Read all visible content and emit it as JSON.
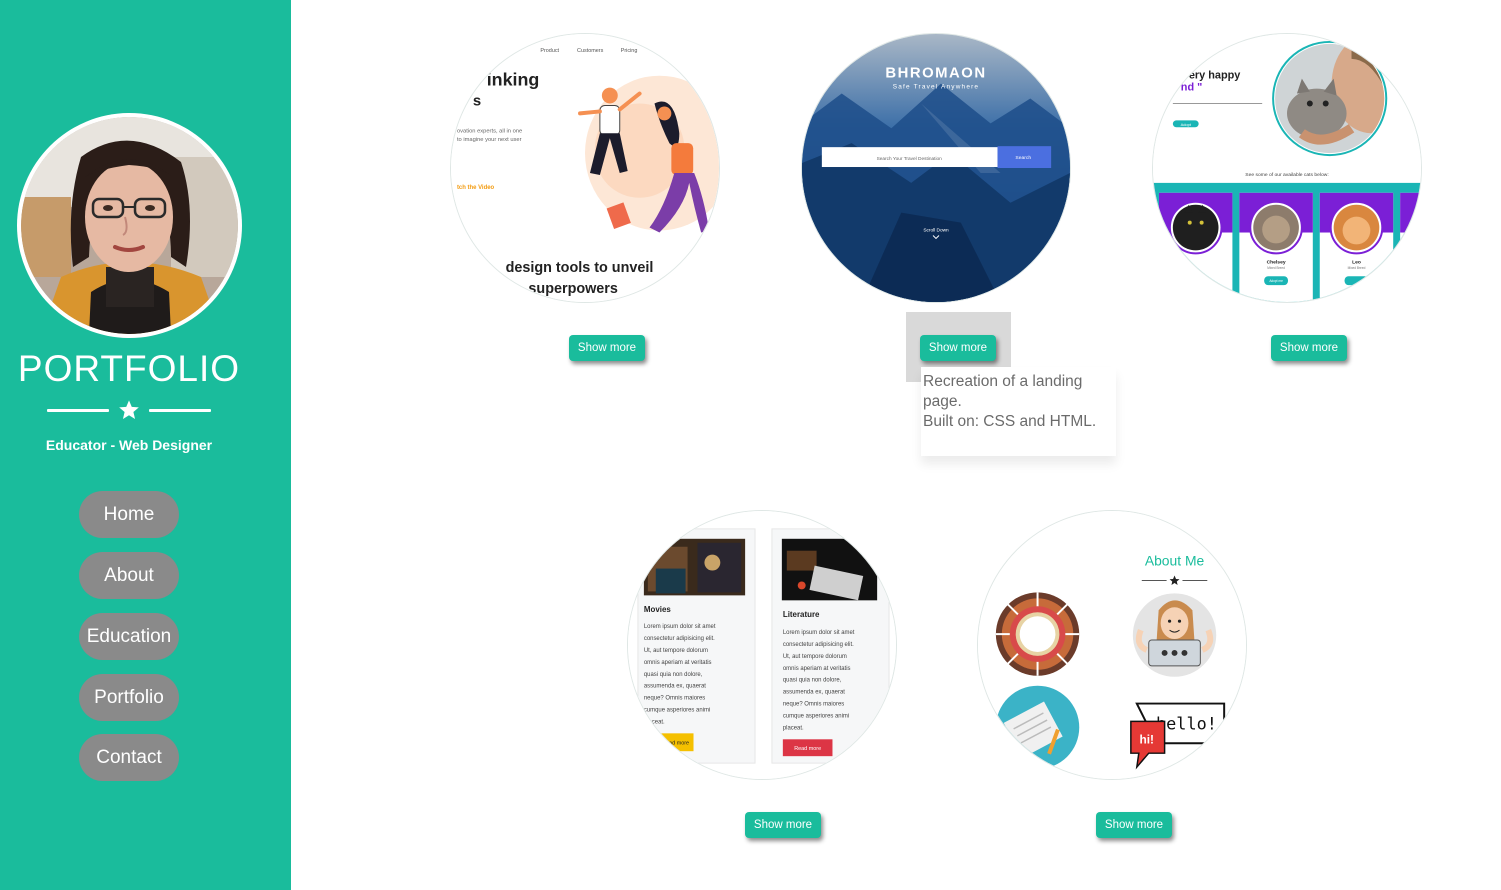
{
  "sidebar": {
    "title": "PORTFOLIO",
    "tagline": "Educator - Web Designer",
    "nav": [
      {
        "label": "Home"
      },
      {
        "label": "About"
      },
      {
        "label": "Education"
      },
      {
        "label": "Portfolio"
      },
      {
        "label": "Contact"
      }
    ]
  },
  "projects": [
    {
      "button": "Show more",
      "preview": {
        "nav": [
          "Product",
          "Customers",
          "Pricing"
        ],
        "heading_1": "inking",
        "heading_2": "s",
        "body_1": "ovation experts, all in one",
        "body_2": "to imagine your next user",
        "link": "tch the Video",
        "footer_1": "design tools to unveil",
        "footer_2": "superpowers"
      }
    },
    {
      "button": "Show more",
      "preview": {
        "brand": "BHROMAON",
        "subtitle": "Safe Travel Anywhere",
        "search_placeholder": "Search Your Travel Destination",
        "search_button": "Search",
        "scroll": "Scroll Down"
      }
    },
    {
      "button": "Show more",
      "preview": {
        "heading_1": "very happy",
        "heading_2": "nd \"",
        "link": "Adopt",
        "caption": "See some of our available cats below:",
        "cats": [
          {
            "name": "",
            "sub": ""
          },
          {
            "name": "Chelsey",
            "sub": "Mixed Breed"
          },
          {
            "name": "Leo",
            "sub": "Mixed Breed"
          }
        ],
        "card_button": "Adopt me"
      }
    },
    {
      "button": "Show more",
      "preview": {
        "cards": [
          {
            "title": "Movies",
            "text": [
              "Lorem ipsum dolor sit amet",
              "consectetur adipisicing elit.",
              "Ut, aut tempore dolorum",
              "omnis aperiam at veritatis",
              "quasi quia non dolore,",
              "assumenda ex, quaerat",
              "neque? Omnis maiores",
              "cumque asperiores animi",
              "placeat."
            ],
            "button": "Read more"
          },
          {
            "title": "Literature",
            "text": [
              "Lorem ipsum dolor sit amet",
              "consectetur adipisicing elit.",
              "Ut, aut tempore dolorum",
              "omnis aperiam at veritatis",
              "quasi quia non dolore,",
              "assumenda ex, quaerat",
              "neque? Omnis maiores",
              "cumque asperiores animi",
              "placeat."
            ],
            "button": "Read more"
          }
        ]
      }
    },
    {
      "button": "Show more",
      "preview": {
        "title": "About Me",
        "bubble_1": "hello!",
        "bubble_2": "hi!"
      }
    }
  ],
  "tooltip": {
    "line1": "Recreation of a landing page.",
    "line2": "Built on: CSS and HTML."
  },
  "colors": {
    "accent": "#1abc9c",
    "nav_button": "#8a8a8a",
    "link_orange": "#f39c12",
    "purple": "#7b1fd6",
    "teal": "#1ab5b5",
    "red_button": "#dc3545"
  }
}
